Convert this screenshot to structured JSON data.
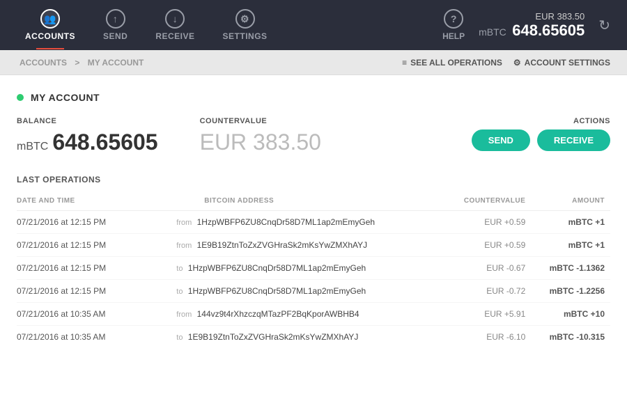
{
  "nav": {
    "items": [
      {
        "id": "accounts",
        "label": "ACCOUNTS",
        "icon": "👥",
        "active": true
      },
      {
        "id": "send",
        "label": "SEND",
        "icon": "↑",
        "active": false
      },
      {
        "id": "receive",
        "label": "RECEIVE",
        "icon": "↓",
        "active": false
      },
      {
        "id": "settings",
        "label": "SETTINGS",
        "icon": "⚙",
        "active": false
      }
    ],
    "help": {
      "label": "HELP",
      "icon": "?"
    },
    "balance": {
      "eur_label": "EUR 383.50",
      "currency": "mBTC",
      "amount": "648.65605"
    },
    "refresh_icon": "↻"
  },
  "breadcrumb": {
    "root": "ACCOUNTS",
    "separator": ">",
    "current": "MY ACCOUNT",
    "see_all_icon": "≡",
    "see_all_label": "SEE ALL OPERATIONS",
    "settings_icon": "⚙",
    "settings_label": "ACCOUNT SETTINGS"
  },
  "account": {
    "dot_color": "#2ecc71",
    "title": "MY ACCOUNT",
    "balance_label": "BALANCE",
    "balance_currency": "mBTC",
    "balance_amount": "648.65605",
    "countervalue_label": "COUNTERVALUE",
    "countervalue_value": "EUR 383.50",
    "actions_label": "ACTIONS",
    "send_label": "SEND",
    "receive_label": "RECEIVE"
  },
  "operations": {
    "title": "LAST OPERATIONS",
    "columns": {
      "date": "DATE AND TIME",
      "address": "BITCOIN ADDRESS",
      "countervalue": "COUNTERVALUE",
      "amount": "AMOUNT"
    },
    "rows": [
      {
        "date": "07/21/2016 at 12:15 PM",
        "direction": "from",
        "address": "1HzpWBFP6ZU8CnqDr58D7ML1ap2mEmyGeh",
        "countervalue": "EUR +0.59",
        "amount": "mBTC +1",
        "amount_type": "positive"
      },
      {
        "date": "07/21/2016 at 12:15 PM",
        "direction": "from",
        "address": "1E9B19ZtnToZxZVGHraSk2mKsYwZMXhAYJ",
        "countervalue": "EUR +0.59",
        "amount": "mBTC +1",
        "amount_type": "positive"
      },
      {
        "date": "07/21/2016 at 12:15 PM",
        "direction": "to",
        "address": "1HzpWBFP6ZU8CnqDr58D7ML1ap2mEmyGeh",
        "countervalue": "EUR -0.67",
        "amount": "mBTC -1.1362",
        "amount_type": "negative"
      },
      {
        "date": "07/21/2016 at 12:15 PM",
        "direction": "to",
        "address": "1HzpWBFP6ZU8CnqDr58D7ML1ap2mEmyGeh",
        "countervalue": "EUR -0.72",
        "amount": "mBTC -1.2256",
        "amount_type": "negative"
      },
      {
        "date": "07/21/2016 at 10:35 AM",
        "direction": "from",
        "address": "144vz9t4rXhzczqMTazPF2BqKporAWBHB4",
        "countervalue": "EUR +5.91",
        "amount": "mBTC +10",
        "amount_type": "positive"
      },
      {
        "date": "07/21/2016 at 10:35 AM",
        "direction": "to",
        "address": "1E9B19ZtnToZxZVGHraSk2mKsYwZMXhAYJ",
        "countervalue": "EUR -6.10",
        "amount": "mBTC -10.315",
        "amount_type": "negative"
      }
    ]
  }
}
